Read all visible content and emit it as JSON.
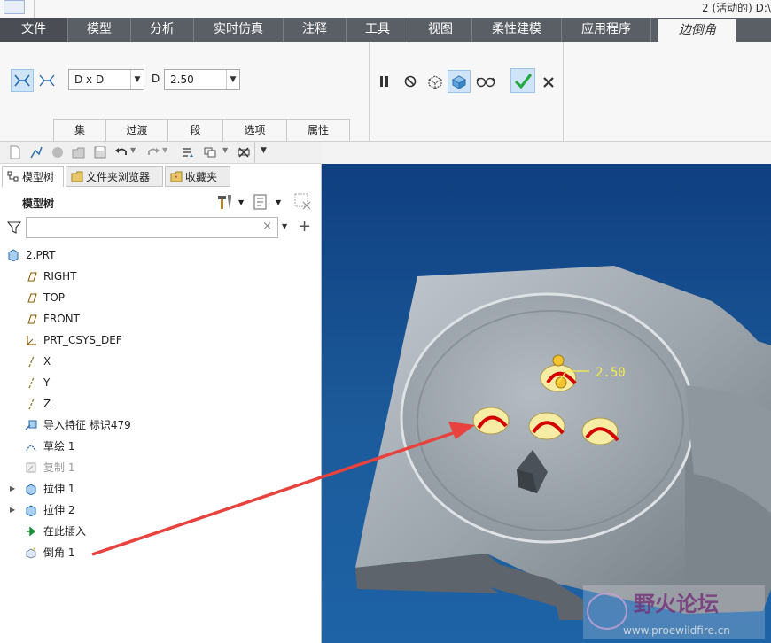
{
  "window": {
    "title": "2 (活动的) D:\\"
  },
  "menu": {
    "file": "文件",
    "tabs": [
      "模型",
      "分析",
      "实时仿真",
      "注释",
      "工具",
      "视图",
      "柔性建模",
      "应用程序"
    ],
    "active_tab": "边倒角"
  },
  "ribbon": {
    "mode_select": "D x D",
    "dim_label": "D",
    "dim_value": "2.50",
    "subtabs": [
      "集",
      "过渡",
      "段",
      "选项",
      "属性"
    ]
  },
  "panel": {
    "tabs": [
      "模型树",
      "文件夹浏览器",
      "收藏夹"
    ],
    "header": "模型树",
    "filter_placeholder": ""
  },
  "tree": {
    "root": "2.PRT",
    "items": [
      {
        "label": "RIGHT",
        "icon": "datum-plane-icon"
      },
      {
        "label": "TOP",
        "icon": "datum-plane-icon"
      },
      {
        "label": "FRONT",
        "icon": "datum-plane-icon"
      },
      {
        "label": "PRT_CSYS_DEF",
        "icon": "csys-icon"
      },
      {
        "label": "X",
        "icon": "datum-axis-icon"
      },
      {
        "label": "Y",
        "icon": "datum-axis-icon"
      },
      {
        "label": "Z",
        "icon": "datum-axis-icon"
      },
      {
        "label": "导入特征 标识479",
        "icon": "import-feature-icon"
      },
      {
        "label": "草绘 1",
        "icon": "sketch-icon"
      },
      {
        "label": "复制 1",
        "icon": "copy-icon",
        "dimmed": true
      },
      {
        "label": "拉伸 1",
        "icon": "extrude-icon",
        "expandable": true
      },
      {
        "label": "拉伸 2",
        "icon": "extrude-icon",
        "expandable": true
      },
      {
        "label": "在此插入",
        "icon": "insert-here-icon"
      },
      {
        "label": "倒角 1",
        "icon": "chamfer-icon"
      }
    ]
  },
  "viewport": {
    "dimension_label": "2.50",
    "watermark_text": "野火论坛",
    "watermark_url": "www.proewildfire.cn"
  },
  "colors": {
    "menubar": "#5a5f66",
    "viewport_top": "#0f3f80",
    "viewport_bottom": "#1d63a6",
    "arrow": "#e8423f",
    "chamfer_handle": "#d40000",
    "marker": "#f2c230",
    "dimension": "#f4f14a",
    "confirm": "#27a844"
  }
}
